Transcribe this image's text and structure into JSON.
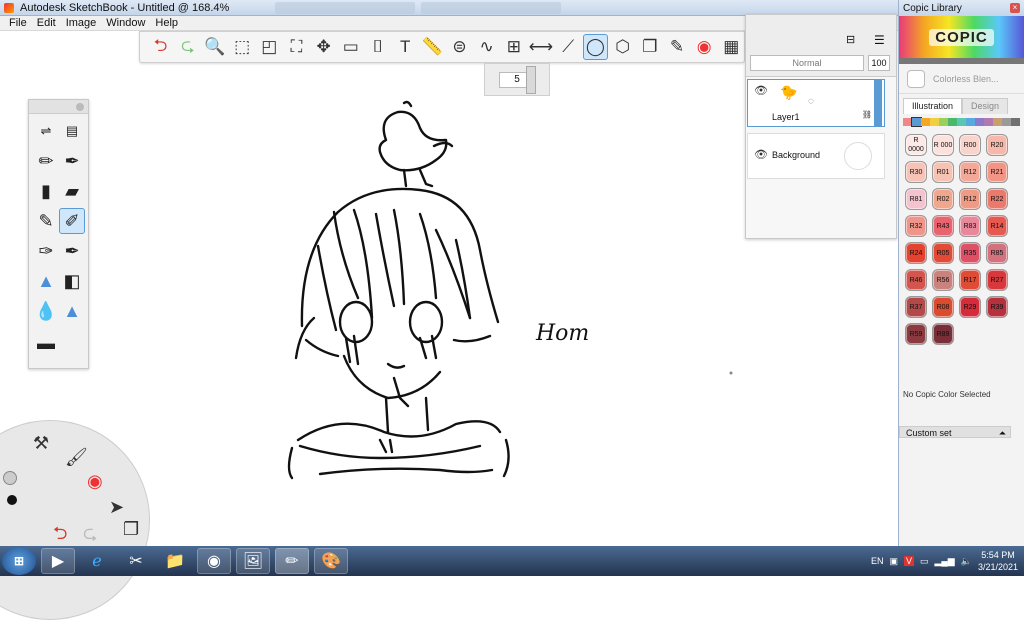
{
  "window": {
    "title": "Autodesk SketchBook - Untitled @ 168.4%"
  },
  "menu": [
    "File",
    "Edit",
    "Image",
    "Window",
    "Help"
  ],
  "toolbar": {
    "undo_icon": "undo-arrow",
    "redo_icon": "redo-arrow",
    "tools": [
      "zoom",
      "select",
      "crop",
      "lasso",
      "transform",
      "ruler",
      "text",
      "measure",
      "ellipse-guide",
      "curve",
      "perspective",
      "symmetry",
      "stroke",
      "shape-ellipse",
      "shape-polygon",
      "copy",
      "brush",
      "color",
      "layout"
    ],
    "active_tool": "shape-ellipse"
  },
  "brush_size": {
    "value": "5"
  },
  "layers": {
    "blend_mode": "Normal",
    "opacity": "100",
    "items": [
      {
        "name": "Layer1",
        "selected": true
      },
      {
        "name": "Background",
        "selected": false
      }
    ]
  },
  "canvas": {
    "signature": "Hom"
  },
  "copic": {
    "title": "Copic Library",
    "logo": "COPIC",
    "colorless": "Colorless Blen...",
    "tabs": [
      "Illustration",
      "Design"
    ],
    "active_tab": "Illustration",
    "swatches": [
      {
        "code": "R 0000",
        "color": "#fde9e6"
      },
      {
        "code": "R 000",
        "color": "#fce1dc"
      },
      {
        "code": "R00",
        "color": "#f9d4cc"
      },
      {
        "code": "R20",
        "color": "#f7b8ac"
      },
      {
        "code": "R30",
        "color": "#f6c3b6"
      },
      {
        "code": "R01",
        "color": "#f5c2b3"
      },
      {
        "code": "R12",
        "color": "#f4a898"
      },
      {
        "code": "R21",
        "color": "#f29584"
      },
      {
        "code": "R81",
        "color": "#f3c4cf"
      },
      {
        "code": "R02",
        "color": "#f1a68e"
      },
      {
        "code": "R12",
        "color": "#ef9a84"
      },
      {
        "code": "R22",
        "color": "#ec7a6c"
      },
      {
        "code": "R32",
        "color": "#f0958a"
      },
      {
        "code": "R43",
        "color": "#ea6470"
      },
      {
        "code": "R83",
        "color": "#e9889b"
      },
      {
        "code": "R14",
        "color": "#e7584f"
      },
      {
        "code": "R24",
        "color": "#e3432f"
      },
      {
        "code": "R05",
        "color": "#e24a36"
      },
      {
        "code": "R35",
        "color": "#de5065"
      },
      {
        "code": "R85",
        "color": "#d4717f"
      },
      {
        "code": "R46",
        "color": "#d3554d"
      },
      {
        "code": "R56",
        "color": "#c9827c"
      },
      {
        "code": "R17",
        "color": "#df4b34"
      },
      {
        "code": "R27",
        "color": "#d8373b"
      },
      {
        "code": "R37",
        "color": "#b24a4a"
      },
      {
        "code": "R08",
        "color": "#db4b2f"
      },
      {
        "code": "R29",
        "color": "#d42c3a"
      },
      {
        "code": "R39",
        "color": "#b5313e"
      },
      {
        "code": "R59",
        "color": "#8b3a3f"
      },
      {
        "code": "R89",
        "color": "#7a2e38"
      }
    ],
    "no_selection": "No Copic Color Selected",
    "custom_set": "Custom set"
  },
  "taskbar": {
    "language": "EN",
    "time": "5:54 PM",
    "date": "3/21/2021",
    "apps": [
      "media-player",
      "internet-explorer",
      "snipping-tool",
      "file-explorer",
      "chrome",
      "paint",
      "sketchbook",
      "sketchbook-pro"
    ]
  }
}
